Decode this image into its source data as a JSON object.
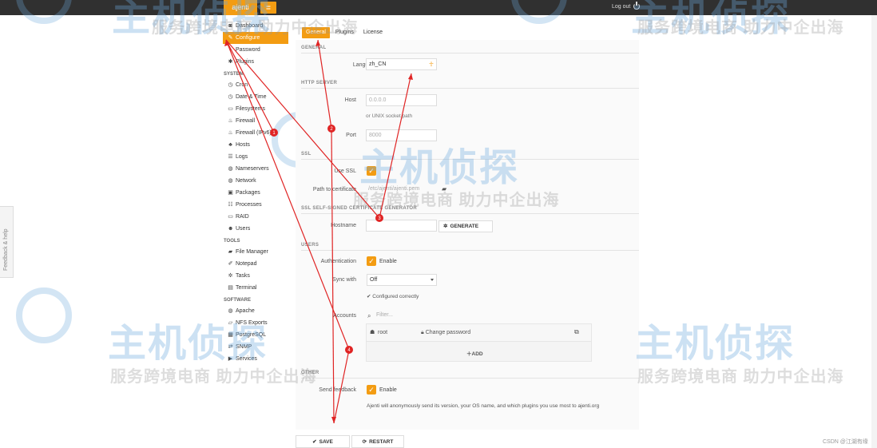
{
  "topbar": {
    "brand": "ajenti",
    "logout": "Log out"
  },
  "sidebar": {
    "top_items": [
      {
        "icon": "dashboard-icon",
        "glyph": "◙",
        "label": "Dashboard"
      },
      {
        "icon": "wrench-icon",
        "glyph": "✎",
        "label": "Configure",
        "active": true
      },
      {
        "icon": "lock-icon",
        "glyph": "▪",
        "label": "Password"
      },
      {
        "icon": "cogs-icon",
        "glyph": "✱",
        "label": "Plugins"
      }
    ],
    "system_header": "SYSTEM",
    "system_items": [
      {
        "icon": "clock-icon",
        "glyph": "◷",
        "label": "Cron"
      },
      {
        "icon": "clock-icon",
        "glyph": "◷",
        "label": "Date & Time"
      },
      {
        "icon": "hdd-icon",
        "glyph": "▭",
        "label": "Filesystems"
      },
      {
        "icon": "fire-icon",
        "glyph": "♨",
        "label": "Firewall"
      },
      {
        "icon": "fire-icon",
        "glyph": "♨",
        "label": "Firewall (IPv6)"
      },
      {
        "icon": "sitemap-icon",
        "glyph": "♣",
        "label": "Hosts"
      },
      {
        "icon": "list-icon",
        "glyph": "☰",
        "label": "Logs"
      },
      {
        "icon": "globe-icon",
        "glyph": "◍",
        "label": "Nameservers"
      },
      {
        "icon": "globe-icon",
        "glyph": "◍",
        "label": "Network"
      },
      {
        "icon": "gift-icon",
        "glyph": "▣",
        "label": "Packages"
      },
      {
        "icon": "th-list-icon",
        "glyph": "☷",
        "label": "Processes"
      },
      {
        "icon": "hdd-icon",
        "glyph": "▭",
        "label": "RAID"
      },
      {
        "icon": "group-icon",
        "glyph": "☻",
        "label": "Users"
      }
    ],
    "tools_header": "TOOLS",
    "tools_items": [
      {
        "icon": "folder-open-icon",
        "glyph": "▰",
        "label": "File Manager"
      },
      {
        "icon": "edit-icon",
        "glyph": "✐",
        "label": "Notepad"
      },
      {
        "icon": "cog-icon",
        "glyph": "✲",
        "label": "Tasks"
      },
      {
        "icon": "terminal-icon",
        "glyph": "▤",
        "label": "Terminal"
      }
    ],
    "software_header": "SOFTWARE",
    "software_items": [
      {
        "icon": "globe-icon",
        "glyph": "◍",
        "label": "Apache"
      },
      {
        "icon": "folder-icon",
        "glyph": "▱",
        "label": "NFS Exports"
      },
      {
        "icon": "storage-icon",
        "glyph": "▦",
        "label": "PostgreSQL"
      },
      {
        "icon": "exchange-icon",
        "glyph": "⇄",
        "label": "SNMP"
      },
      {
        "icon": "play-icon",
        "glyph": "▶",
        "label": "Services"
      }
    ]
  },
  "tabs": [
    "General",
    "Plugins",
    "License"
  ],
  "sections": {
    "general": "GENERAL",
    "http": "HTTP SERVER",
    "ssl": "SSL",
    "ssl_gen": "SSL SELF-SIGNED CERTIFICATE GENERATOR",
    "users": "USERS",
    "other": "OTHER"
  },
  "form": {
    "language_label": "Language",
    "language_value": "zh_CN",
    "host_label": "Host",
    "host_value": "0.0.0.0",
    "host_hint": "or UNIX socket path",
    "port_label": "Port",
    "port_value": "8000",
    "use_ssl_label": "Use SSL",
    "cert_label": "Path to certificate",
    "cert_value": "/etc/ajenti/ajenti.pem",
    "hostname_label": "Hostname",
    "hostname_value": "",
    "generate_label": "GENERATE",
    "auth_label": "Authentication",
    "enable_label": "Enable",
    "sync_label": "Sync with",
    "sync_value": "Off",
    "configured_text": "Configured correctly",
    "accounts_label": "Accounts",
    "filter_placeholder": "Filter...",
    "user_name": "root",
    "change_password": "Change password",
    "add_label": "ADD",
    "feedback_label": "Send feedback",
    "feedback_enable": "Enable",
    "feedback_note": "Ajenti will anonymously send its version, your OS name, and which plugins you use most to ajenti.org"
  },
  "buttons": {
    "save": "SAVE",
    "restart": "RESTART"
  },
  "feedback_tab": "Feedback & help",
  "footer_credit": "CSDN @江湖有缘",
  "watermark": {
    "big": "主机侦探",
    "small": "服务跨境电商 助力中企出海"
  },
  "annotation_markers": [
    "1",
    "2",
    "3",
    "4"
  ],
  "colors": {
    "accent": "#f39c12",
    "topbar": "#303030",
    "arrow": "#e02424"
  }
}
